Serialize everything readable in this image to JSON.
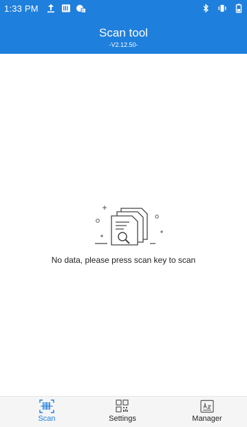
{
  "status_bar": {
    "time": "1:33 PM",
    "left_icons": [
      "upload-icon",
      "sim-card-icon",
      "data-icon"
    ],
    "right_icons": [
      "bluetooth-icon",
      "vibrate-icon",
      "battery-icon"
    ]
  },
  "header": {
    "title": "Scan tool",
    "version": "-V2.12.50-",
    "background_color": "#1f7fdc"
  },
  "empty_state": {
    "icon": "document-search-icon",
    "message": "No data, please press scan key to scan"
  },
  "bottom_nav": {
    "items": [
      {
        "label": "Scan",
        "icon": "barcode-icon",
        "active": true
      },
      {
        "label": "Settings",
        "icon": "qr-grid-icon",
        "active": false
      },
      {
        "label": "Manager",
        "icon": "id-card-icon",
        "active": false
      }
    ],
    "active_color": "#1f7fdc"
  }
}
